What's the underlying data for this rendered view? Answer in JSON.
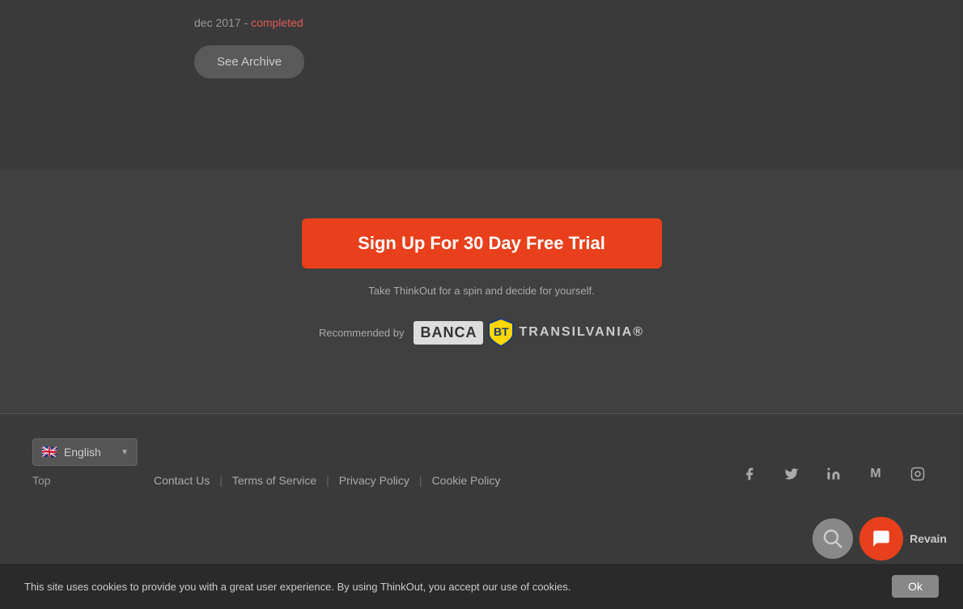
{
  "top": {
    "date_label": "dec 2017 - ",
    "completed_label": "completed",
    "archive_button": "See Archive"
  },
  "middle": {
    "signup_button": "Sign Up For 30 Day Free Trial",
    "tagline": "Take ThinkOut for a spin and decide for yourself.",
    "recommended_by_label": "Recommended by",
    "banca_name": "BANCA",
    "transilvania_name": "TRANSILVANIA®"
  },
  "footer": {
    "lang_label": "English",
    "top_link": "Top",
    "links": [
      {
        "label": "Contact Us",
        "href": "#"
      },
      {
        "label": "Terms of Service",
        "href": "#"
      },
      {
        "label": "Privacy Policy",
        "href": "#"
      },
      {
        "label": "Cookie Policy",
        "href": "#"
      }
    ],
    "social": [
      {
        "name": "facebook",
        "icon": "f"
      },
      {
        "name": "twitter",
        "icon": "t"
      },
      {
        "name": "linkedin",
        "icon": "in"
      },
      {
        "name": "medium",
        "icon": "M"
      },
      {
        "name": "instagram",
        "icon": "ig"
      }
    ]
  },
  "cookie_banner": {
    "text": "This site uses cookies to provide you with a great user experience. By using ThinkOut, you accept our use of cookies.",
    "ok_button": "Ok"
  },
  "revain": {
    "label": "Revain"
  }
}
